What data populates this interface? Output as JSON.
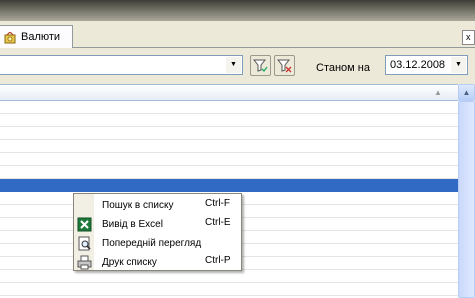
{
  "tab": {
    "label": "Валюти",
    "close": "x"
  },
  "toolbar": {
    "filter_combo_value": "",
    "stanom_label": "Станом на",
    "date_value": "03.12.2008"
  },
  "grid": {
    "selected_row_index": 6
  },
  "context_menu": {
    "items": [
      {
        "label": "Пошук в списку",
        "shortcut": "Ctrl-F",
        "icon": "none"
      },
      {
        "label": "Вивід в Excel",
        "shortcut": "Ctrl-E",
        "icon": "excel-icon"
      },
      {
        "label": "Попередній перегляд",
        "shortcut": "",
        "icon": "print-preview-icon"
      },
      {
        "label": "Друк списку",
        "shortcut": "Ctrl-P",
        "icon": "printer-icon"
      }
    ]
  },
  "colors": {
    "selection": "#316ac5",
    "window_bg": "#ece9d8"
  }
}
